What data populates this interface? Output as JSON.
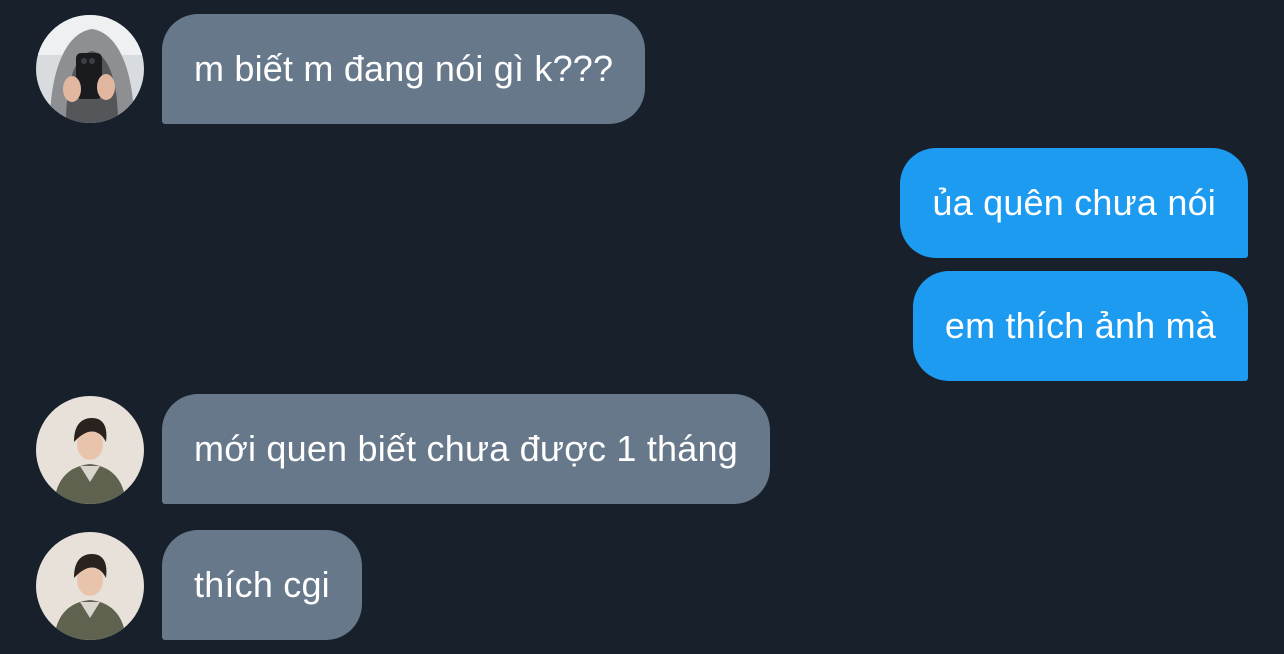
{
  "conversation": {
    "messages": [
      {
        "direction": "incoming",
        "text": "m biết m đang nói gì k???",
        "avatar": "avatar-mirror-selfie"
      },
      {
        "direction": "outgoing",
        "text": "ủa quên chưa nói"
      },
      {
        "direction": "outgoing",
        "text": "em thích ảnh mà"
      },
      {
        "direction": "incoming",
        "text": "mới quen biết chưa được 1 tháng",
        "avatar": "avatar-portrait"
      },
      {
        "direction": "incoming",
        "text": "thích cgi",
        "avatar": "avatar-portrait"
      }
    ]
  },
  "colors": {
    "background": "#17202b",
    "incoming_bubble": "#66788a",
    "outgoing_bubble": "#1d9bf0",
    "text": "#ffffff"
  }
}
